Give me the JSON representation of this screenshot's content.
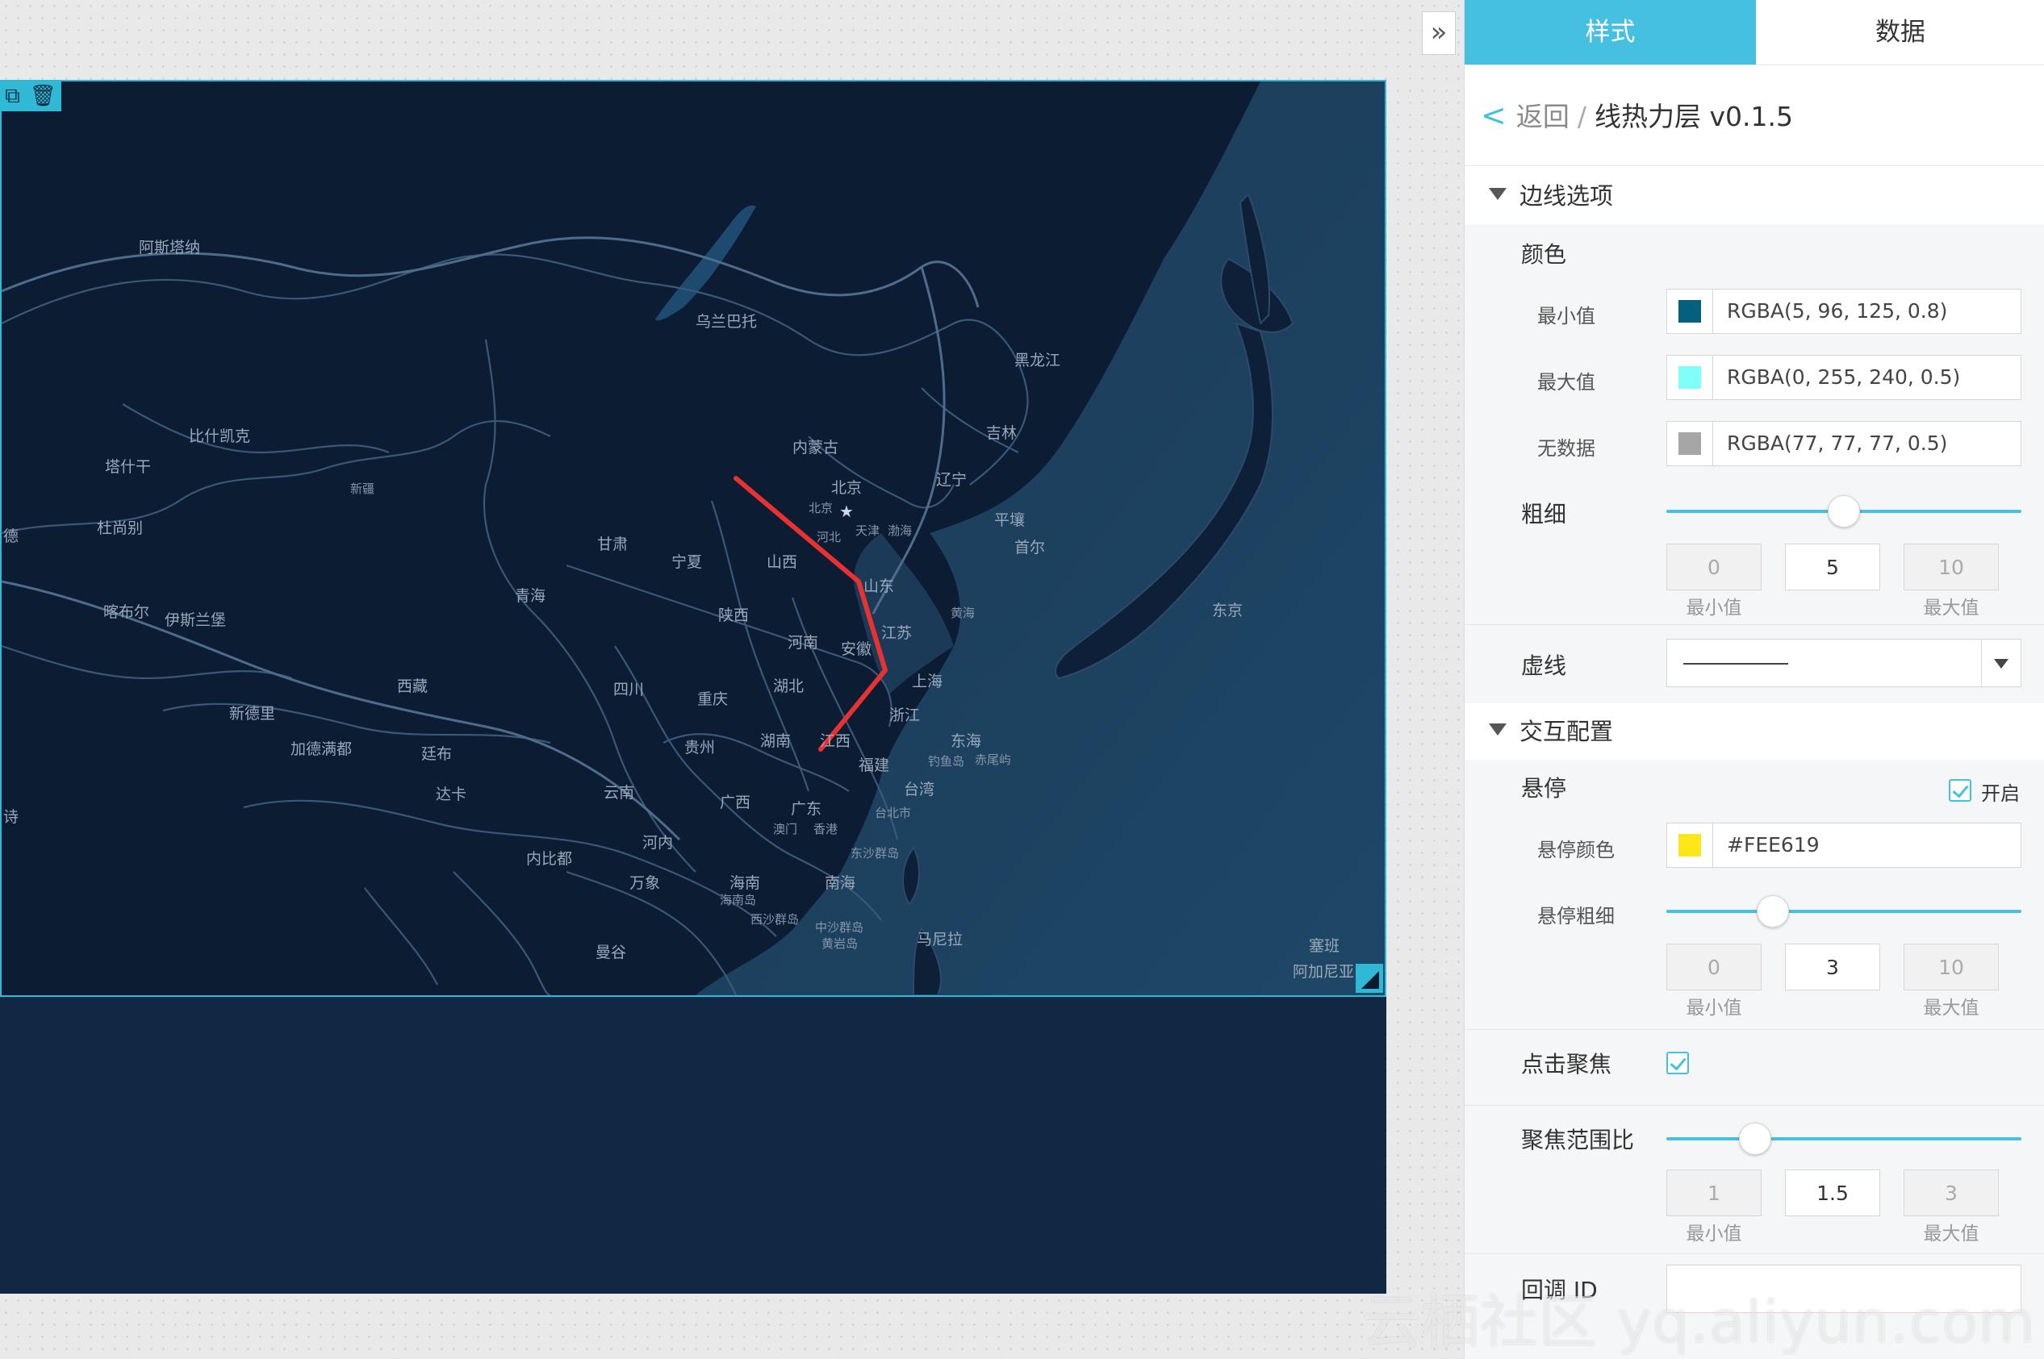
{
  "tabs": {
    "style": "样式",
    "data": "数据"
  },
  "breadcrumb": {
    "back": "返回",
    "separator": "/",
    "title": "线热力层 v0.1.5"
  },
  "edge_options": {
    "title": "边线选项",
    "color_label": "颜色",
    "min": {
      "label": "最小值",
      "value": "RGBA(5, 96, 125, 0.8)",
      "swatch": "#05607d"
    },
    "max": {
      "label": "最大值",
      "value": "RGBA(0, 255, 240, 0.5)",
      "swatch": "#7ffff7"
    },
    "nodata": {
      "label": "无数据",
      "value": "RGBA(77, 77, 77, 0.5)",
      "swatch": "#a6a6a6"
    },
    "thickness": {
      "label": "粗细",
      "min": "0",
      "value": "5",
      "max": "10",
      "min_caption": "最小值",
      "max_caption": "最大值",
      "fraction": 0.5
    },
    "dash_label": "虚线"
  },
  "interaction": {
    "title": "交互配置",
    "hover_label": "悬停",
    "hover_enable_label": "开启",
    "hover_enabled": true,
    "hover_color": {
      "label": "悬停颜色",
      "value": "#FEE619",
      "swatch": "#fee619"
    },
    "hover_thickness": {
      "label": "悬停粗细",
      "min": "0",
      "value": "3",
      "max": "10",
      "min_caption": "最小值",
      "max_caption": "最大值",
      "fraction": 0.3
    },
    "click_focus_label": "点击聚焦",
    "click_focus_enabled": true,
    "focus_ratio": {
      "label": "聚焦范围比",
      "min": "1",
      "value": "1.5",
      "max": "3",
      "min_caption": "最小值",
      "max_caption": "最大值",
      "fraction": 0.25
    },
    "callback_label": "回调 ID",
    "callback_value": ""
  },
  "map": {
    "labels": [
      "阿斯塔纳",
      "乌兰巴托",
      "黑龙江",
      "吉林",
      "比什凯克",
      "塔什干",
      "新疆",
      "内蒙古",
      "辽宁",
      "北京",
      "北京",
      "天津",
      "渤海",
      "河北",
      "平壤",
      "首尔",
      "杜尚别",
      "甘肃",
      "宁夏",
      "山西",
      "山东",
      "喀布尔",
      "伊斯兰堡",
      "青海",
      "陕西",
      "黄海",
      "河南",
      "东京",
      "江苏",
      "安徽",
      "西藏",
      "四川",
      "湖北",
      "上海",
      "重庆",
      "新德里",
      "浙江",
      "加德满都",
      "廷布",
      "贵州",
      "湖南",
      "江西",
      "东海",
      "钓鱼岛",
      "赤尾屿",
      "福建",
      "台湾",
      "达卡",
      "云南",
      "广西",
      "广东",
      "澳门",
      "香港",
      "台北市",
      "河内",
      "东沙群岛",
      "内比都",
      "万象",
      "海南",
      "南海",
      "海南岛",
      "西沙群岛",
      "中沙群岛",
      "黄岩岛",
      "马尼拉",
      "曼谷",
      "塞班",
      "阿加尼亚",
      "德",
      "诗"
    ],
    "route_color": "#e83232",
    "background": "#0b1a30"
  },
  "toolbar": {
    "copy_icon": "copy-icon",
    "delete_icon": "trash-icon"
  },
  "watermark": "云栖社区 yq.aliyun.com"
}
